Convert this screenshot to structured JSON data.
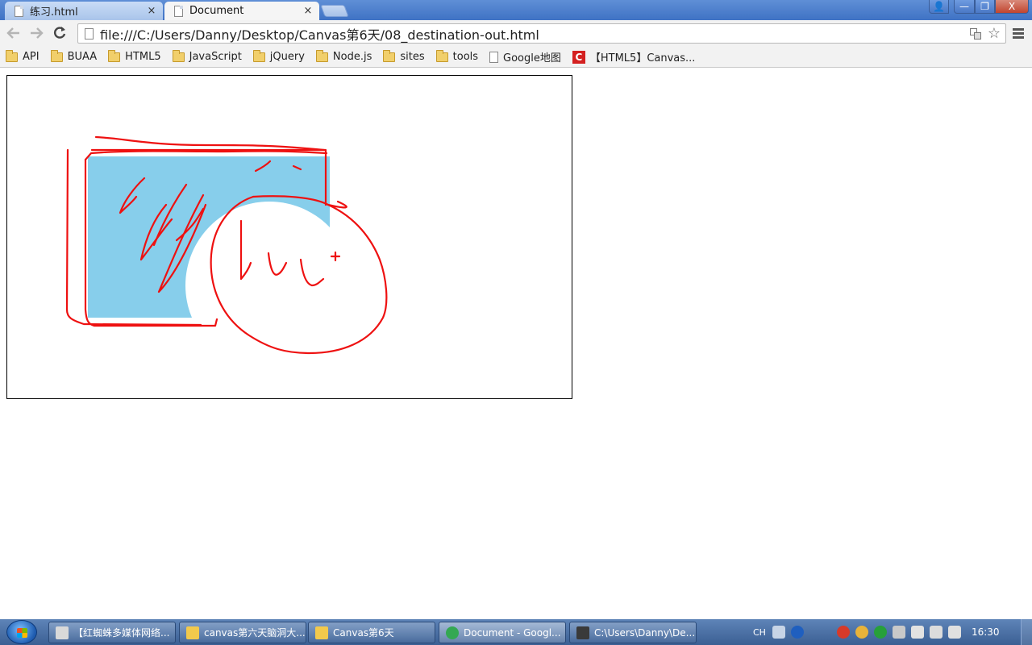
{
  "browser": {
    "tabs": [
      {
        "label": "练习.html",
        "active": false
      },
      {
        "label": "Document",
        "active": true
      }
    ],
    "tab_close_glyph": "×",
    "window_buttons": {
      "user": "👤",
      "minimize": "—",
      "maximize": "❐",
      "close": "X"
    },
    "address": "file:///C:/Users/Danny/Desktop/Canvas第6天/08_destination-out.html",
    "bookmarks": [
      {
        "label": "API",
        "icon": "folder-icon"
      },
      {
        "label": "BUAA",
        "icon": "folder-icon"
      },
      {
        "label": "HTML5",
        "icon": "folder-icon"
      },
      {
        "label": "JavaScript",
        "icon": "folder-icon"
      },
      {
        "label": "jQuery",
        "icon": "folder-icon"
      },
      {
        "label": "Node.js",
        "icon": "folder-icon"
      },
      {
        "label": "sites",
        "icon": "folder-icon"
      },
      {
        "label": "tools",
        "icon": "folder-icon"
      },
      {
        "label": "Google地图",
        "icon": "page-icon"
      },
      {
        "label": "【HTML5】Canvas...",
        "icon": "red-c-icon"
      }
    ],
    "red_c_glyph": "C"
  },
  "canvas": {
    "fill_color": "#87ceeb",
    "stroke_color": "#ee1111"
  },
  "taskbar": {
    "items": [
      {
        "label": "【红蜘蛛多媒体网络...",
        "icon_color": "#d9d9d9",
        "active": false
      },
      {
        "label": "canvas第六天脑洞大...",
        "icon_color": "#f2c94c",
        "active": false
      },
      {
        "label": "Canvas第6天",
        "icon_color": "#f2c94c",
        "active": false
      },
      {
        "label": "Document - Googl...",
        "icon_color": "#34a853",
        "active": true
      },
      {
        "label": "C:\\Users\\Danny\\De...",
        "icon_color": "#3a3a3a",
        "active": false
      }
    ],
    "tray": {
      "ime": "CH",
      "time": "16:30"
    }
  }
}
